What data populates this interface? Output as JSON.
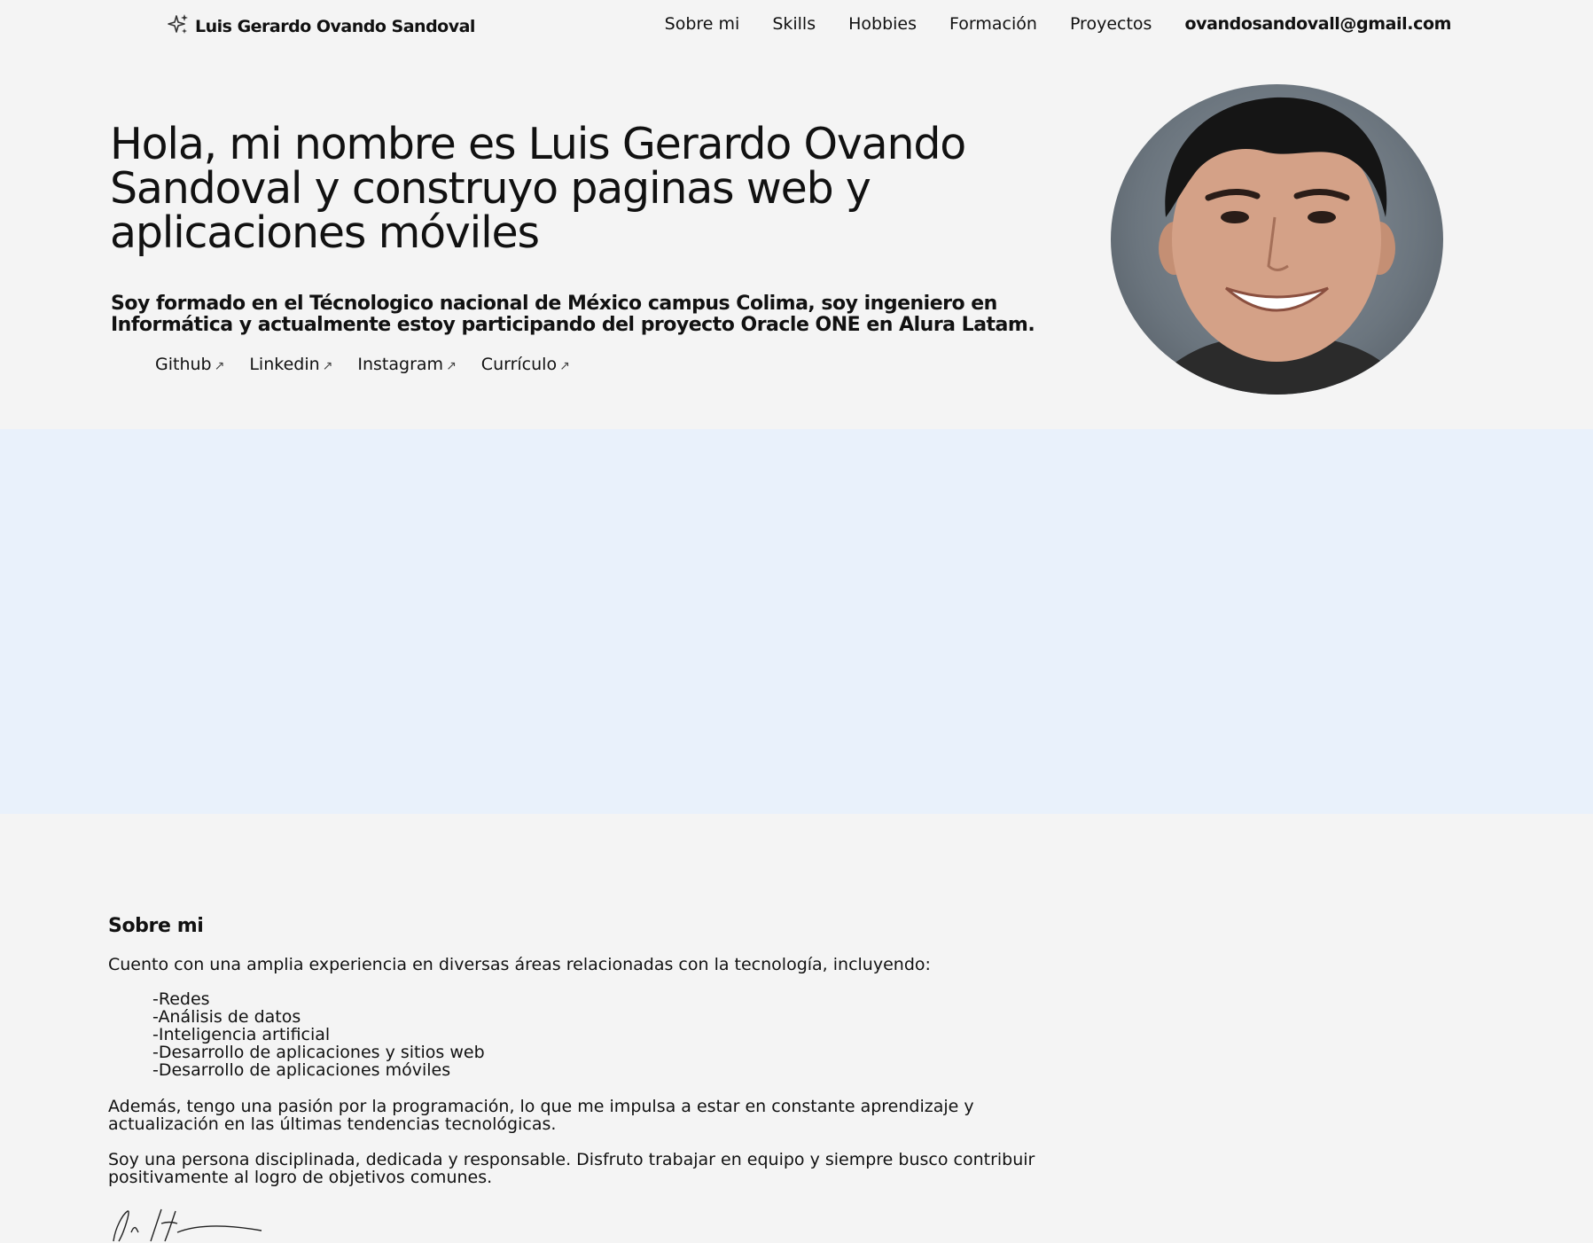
{
  "nav": {
    "brand_icon": "sparkle-icon",
    "brand_name": "Luis Gerardo Ovando Sandoval",
    "links": [
      "Sobre mi",
      "Skills",
      "Hobbies",
      "Formación",
      "Proyectos"
    ],
    "email": "ovandosandovall@gmail.com"
  },
  "hero": {
    "title": "Hola, mi nombre es Luis Gerardo Ovando Sandoval y construyo paginas web y aplicaciones móviles",
    "subtitle": "Soy formado en el Técnologico nacional de México campus Colima, soy ingeniero en Informática y actualmente estoy participando del proyecto Oracle ONE en Alura Latam.",
    "links": [
      "Github",
      "Linkedin",
      "Instagram",
      "Currículo"
    ],
    "link_icon": "arrow-up-right-icon"
  },
  "about": {
    "title": "Sobre mi",
    "intro": "Cuento con una amplia experiencia en diversas áreas relacionadas con la tecnología, incluyendo:",
    "list": [
      "-Redes",
      "-Análisis de datos",
      "-Inteligencia artificial",
      "-Desarrollo de aplicaciones y sitios web",
      "-Desarrollo de aplicaciones móviles"
    ],
    "p2": "Además, tengo una pasión por la programación, lo que me impulsa a estar en constante aprendizaje y actualización en las últimas tendencias tecnológicas.",
    "p3": "Soy una persona disciplinada, dedicada y responsable. Disfruto trabajar en equipo y siempre busco contribuir positivamente al logro de objetivos comunes."
  },
  "colors": {
    "hero_bg": "#f4f4f4",
    "about_bg": "#e9f1fb",
    "text": "#111111"
  }
}
